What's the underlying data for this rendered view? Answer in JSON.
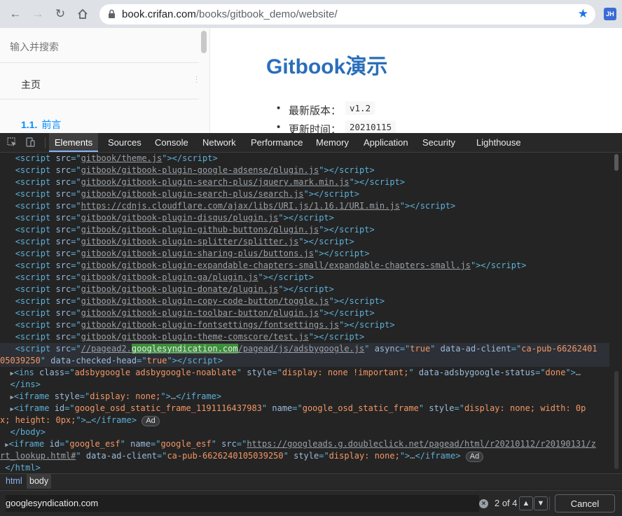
{
  "browser": {
    "url_domain": "book.crifan.com",
    "url_path": "/books/gitbook_demo/website/",
    "profile_initials": "JH"
  },
  "page": {
    "search_placeholder": "输入并搜索",
    "nav_home": "主页",
    "nav_section_number": "1.1.",
    "nav_section_label": "前言",
    "title": "Gitbook演示",
    "meta": [
      {
        "label": "最新版本：",
        "value": "v1.2"
      },
      {
        "label": "更新时间：",
        "value": "20210115"
      }
    ]
  },
  "devtools": {
    "tabs": [
      "Elements",
      "Sources",
      "Console",
      "Network",
      "Performance",
      "Memory",
      "Application",
      "Security",
      "Lighthouse"
    ],
    "active_tab": "Elements",
    "script_srcs": [
      "gitbook/theme.js",
      "gitbook/gitbook-plugin-google-adsense/plugin.js",
      "gitbook/gitbook-plugin-search-plus/jquery.mark.min.js",
      "gitbook/gitbook-plugin-search-plus/search.js",
      "https://cdnjs.cloudflare.com/ajax/libs/URI.js/1.16.1/URI.min.js",
      "gitbook/gitbook-plugin-disqus/plugin.js",
      "gitbook/gitbook-plugin-github-buttons/plugin.js",
      "gitbook/gitbook-plugin-splitter/splitter.js",
      "gitbook/gitbook-plugin-sharing-plus/buttons.js",
      "gitbook/gitbook-plugin-expandable-chapters-small/expandable-chapters-small.js",
      "gitbook/gitbook-plugin-ga/plugin.js",
      "gitbook/gitbook-plugin-donate/plugin.js",
      "gitbook/gitbook-plugin-copy-code-button/toggle.js",
      "gitbook/gitbook-plugin-toolbar-button/plugin.js",
      "gitbook/gitbook-plugin-fontsettings/fontsettings.js",
      "gitbook/gitbook-plugin-theme-comscore/test.js"
    ],
    "ads_script": {
      "src_before": "//pagead2.",
      "src_match": "googlesyndication.com",
      "src_after": "/pagead/js/adsbygoogle.js",
      "async": "true",
      "ad_client_1": "ca-pub-66262401",
      "ad_client_2": "05039250",
      "checked_head": "true"
    },
    "ins_line": {
      "class": "adsbygoogle adsbygoogle-noablate",
      "style": "display: none !important;",
      "status": "done"
    },
    "iframe1_style": "display: none;",
    "iframe2": {
      "id": "google_osd_static_frame_1191116437983",
      "name": "google_osd_static_frame",
      "style_1": "display: none; width: 0p",
      "style_2": "x; height: 0px;"
    },
    "iframe3": {
      "id": "google_esf",
      "name": "google_esf",
      "src_1": "https://googleads.g.doubleclick.net/pagead/html/r20210112/r20190131/z",
      "src_2": "rt_lookup.html#",
      "ad_client": "ca-pub-6626240105039250",
      "style": "display: none;"
    },
    "ad_badge": "Ad",
    "breadcrumbs": [
      "html",
      "body"
    ],
    "find": {
      "query": "googlesyndication.com",
      "count": "2 of 4",
      "cancel_label": "Cancel"
    }
  }
}
